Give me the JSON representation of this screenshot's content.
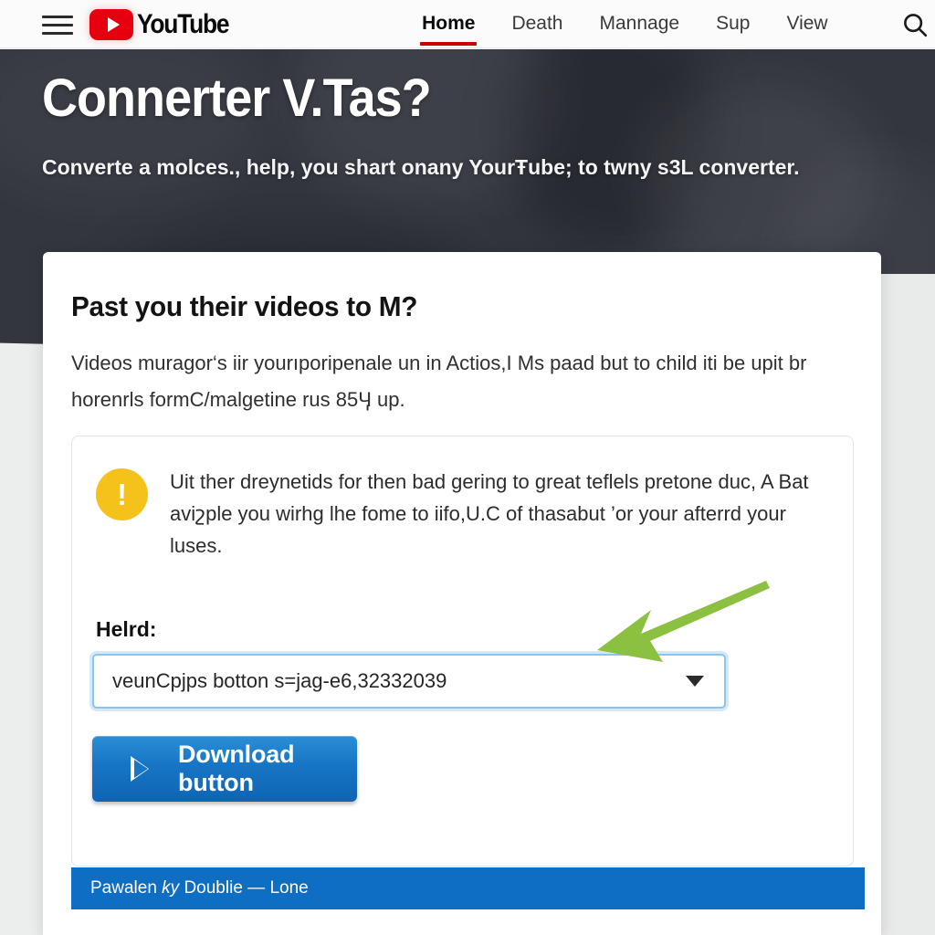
{
  "nav": {
    "menu_icon": "hamburger-menu-icon",
    "logo_text": "YouTube",
    "logo_icon": "youtube-play-icon",
    "search_icon": "search-icon",
    "links": [
      {
        "label": "Home",
        "active": true
      },
      {
        "label": "Death",
        "active": false
      },
      {
        "label": "Mannage",
        "active": false
      },
      {
        "label": "Sup",
        "active": false
      },
      {
        "label": "View",
        "active": false
      }
    ]
  },
  "hero": {
    "title": "Connerter V.Tas?",
    "subtitle": "Converte a molces., help, you shart onany YourŦube; to twny s3L converter."
  },
  "card": {
    "title": "Past you their videos to M?",
    "body": "Videos muragor‘s iir yourıporipenale un in Actios,I Ms paad but to child iti be upit br horenrls formC/malgetine rus 85Ӌ up.",
    "alert": {
      "icon": "warning-exclamation-icon",
      "text": "Uit ther dreynetids for then bad gering to great teflels pretone duc, A Bat aviշple you wirhg lhe fome to iifo,U.C of thasabut ’or your afterrd your luses."
    },
    "field": {
      "label": "Helrd:",
      "value": "veunCpjps botton s=jag-e6,32332039",
      "caret_icon": "chevron-down-icon"
    },
    "download_button": {
      "label": "Download button",
      "icon": "play-triangle-icon"
    },
    "bottom_bar": {
      "prefix": "Pawalen ",
      "emphasis": "ky",
      "suffix": " Doublie — Lone"
    }
  },
  "annotation": {
    "arrow_icon": "green-arrow-pointing-to-select"
  },
  "colors": {
    "hero_bg": "#33363f",
    "brand_red": "#e6000f",
    "active_underline": "#cc0000",
    "alert_yellow": "#f5c21b",
    "button_blue": "#1876c6",
    "bar_blue": "#0e6ec4",
    "arrow_green": "#8cc040",
    "focus_ring": "#8cc4ee",
    "page_bg": "#eceded"
  }
}
